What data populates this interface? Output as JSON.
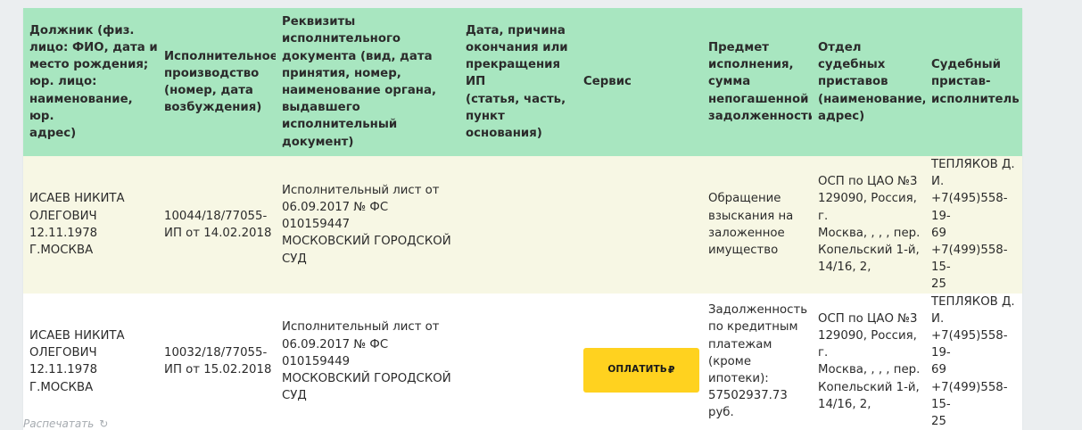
{
  "table": {
    "headers": [
      "Должник (физ.\nлицо: ФИО, дата и\nместо рождения;\nюр. лицо:\nнаименование, юр.\nадрес)",
      "Исполнительное\nпроизводство\n(номер, дата\nвозбуждения)",
      "Реквизиты\nисполнительного\nдокумента (вид, дата\nпринятия, номер,\nнаименование органа,\nвыдавшего\nисполнительный\nдокумент)",
      "Дата, причина\nокончания или\nпрекращения ИП\n(статья, часть,\nпункт основания)",
      "Сервис",
      "Предмет\nисполнения,\nсумма\nнепогашенной\nзадолженности",
      "Отдел судебных\nприставов\n(наименование,\nадрес)",
      "Судебный\nпристав-\nисполнитель"
    ],
    "rows": [
      {
        "debtor": "ИСАЕВ НИКИТА\nОЛЕГОВИЧ\n12.11.1978\nГ.МОСКВА",
        "proceeding": "10044/18/77055-\nИП от 14.02.2018",
        "document": "Исполнительный лист от\n06.09.2017 № ФС 010159447\nМОСКОВСКИЙ ГОРОДСКОЙ\nСУД",
        "end_reason": "",
        "service": "",
        "subject": "Обращение\nвзыскания на\nзаложенное\nимущество",
        "department": "ОСП по ЦАО №3\n129090, Россия, г.\nМосква, , , , пер.\nКопельский 1-й,\n14/16, 2,",
        "bailiff": "ТЕПЛЯКОВ Д.\nИ.\n+7(495)558-19-\n69\n+7(499)558-15-\n25"
      },
      {
        "debtor": "ИСАЕВ НИКИТА\nОЛЕГОВИЧ\n12.11.1978\nГ.МОСКВА",
        "proceeding": "10032/18/77055-\nИП от 15.02.2018",
        "document": "Исполнительный лист от\n06.09.2017 № ФС 010159449\nМОСКОВСКИЙ ГОРОДСКОЙ\nСУД",
        "end_reason": "",
        "service": "ОПЛАТИТЬ",
        "subject": "Задолженность\nпо кредитным\nплатежам\n(кроме ипотеки):\n57502937.73 руб.",
        "department": "ОСП по ЦАО №3\n129090, Россия, г.\nМосква, , , , пер.\nКопельский 1-й,\n14/16, 2,",
        "bailiff": "ТЕПЛЯКОВ Д.\nИ.\n+7(495)558-19-\n69\n+7(499)558-15-\n25"
      }
    ]
  },
  "pay_button": {
    "currency_symbol": "₽"
  },
  "footer": {
    "link_label": "Распечатать",
    "refresh_icon": "refresh-icon"
  },
  "colors": {
    "header_bg": "#a8e6c0",
    "row_odd_bg": "#f7f7e4",
    "button_bg": "#ffd21f"
  }
}
